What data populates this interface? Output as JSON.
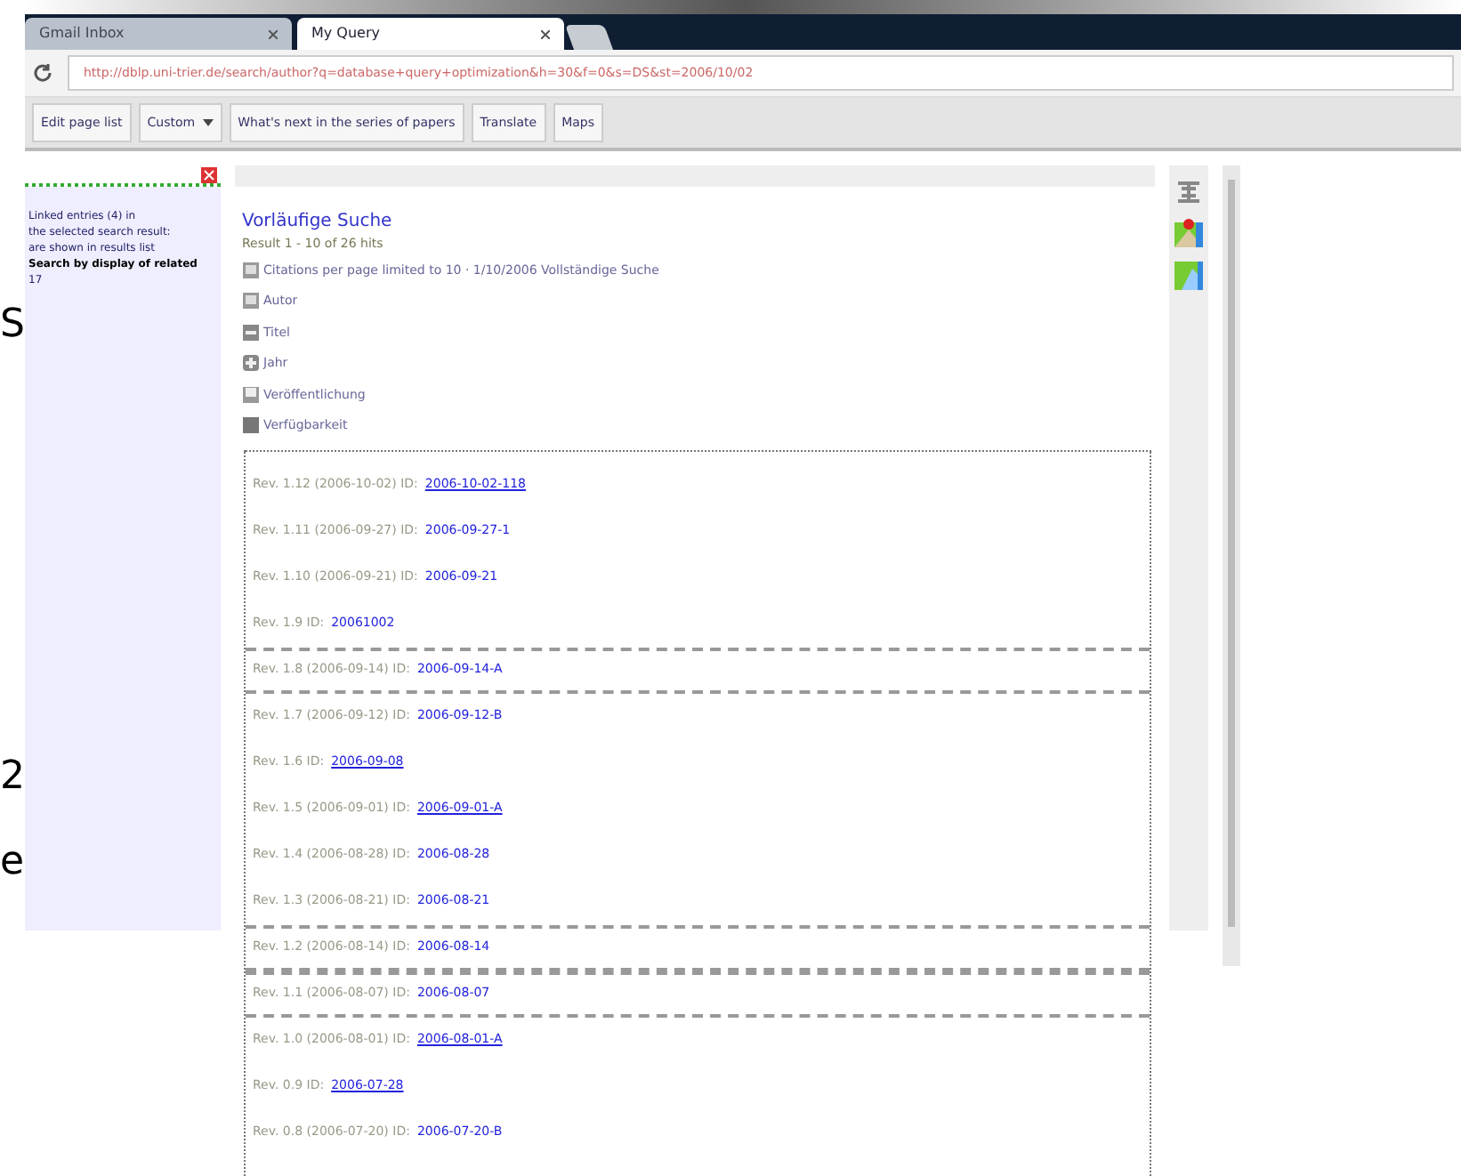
{
  "background_letters": [
    "S",
    "2",
    "e"
  ],
  "browser": {
    "tabs": [
      {
        "title": "Gmail Inbox",
        "selected": false
      },
      {
        "title": "My Query",
        "selected": true
      }
    ],
    "address": "http://dblp.uni-trier.de/search/author?q=database+query+optimization&h=30&f=0&s=DS&st=2006/10/02",
    "bookmarks": [
      {
        "label": "Edit page list",
        "menu": false
      },
      {
        "label": "Custom",
        "menu": true
      },
      {
        "label": "What's next in the series of papers",
        "menu": false
      },
      {
        "label": "Translate",
        "menu": false
      },
      {
        "label": "Maps",
        "menu": false
      }
    ]
  },
  "side_panel": {
    "lines": [
      "Linked entries (4) in ",
      "the selected search result:",
      "are shown in results list",
      "Search by display of related",
      "17"
    ]
  },
  "results": {
    "title": "Vorläufige Suche",
    "subtitle": "Result 1 - 10 of 26 hits",
    "filters": [
      {
        "kind": "list",
        "label": "Citations per page limited to 10 · 1/10/2006 Vollständige Suche"
      },
      {
        "kind": "list",
        "label": "Autor"
      },
      {
        "kind": "minus",
        "label": "Titel"
      },
      {
        "kind": "plus",
        "label": "Jahr"
      },
      {
        "kind": "tray",
        "label": "Veröffentlichung"
      },
      {
        "kind": "block",
        "label": "Verfügbarkeit"
      }
    ],
    "entries": [
      {
        "text": "Rev. 1.12 (2006-10-02) ID:",
        "link": "2006-10-02-118",
        "underlined": true,
        "boxed": false
      },
      {
        "text": "Rev. 1.11 (2006-09-27) ID:",
        "link": "2006-09-27-1",
        "underlined": false,
        "boxed": false
      },
      {
        "text": "Rev. 1.10 (2006-09-21) ID:",
        "link": "2006-09-21",
        "underlined": false,
        "boxed": false
      },
      {
        "text": "Rev. 1.9 ID:",
        "link": "20061002",
        "underlined": false,
        "boxed": false
      },
      {
        "text": "Rev. 1.8 (2006-09-14) ID:",
        "link": "2006-09-14-A",
        "underlined": false,
        "boxed": true
      },
      {
        "text": "Rev. 1.7 (2006-09-12) ID:",
        "link": "2006-09-12-B",
        "underlined": false,
        "boxed": false
      },
      {
        "text": "Rev. 1.6 ID:",
        "link": "2006-09-08",
        "underlined": true,
        "boxed": false
      },
      {
        "text": "Rev. 1.5 (2006-09-01) ID:",
        "link": "2006-09-01-A",
        "underlined": true,
        "boxed": false
      },
      {
        "text": "Rev. 1.4 (2006-08-28) ID:",
        "link": "2006-08-28",
        "underlined": false,
        "boxed": false
      },
      {
        "text": "Rev. 1.3 (2006-08-21) ID:",
        "link": "2006-08-21",
        "underlined": false,
        "boxed": false
      },
      {
        "text": "Rev. 1.2 (2006-08-14) ID:",
        "link": "2006-08-14",
        "underlined": false,
        "boxed": true
      },
      {
        "text": "Rev. 1.1 (2006-08-07) ID:",
        "link": "2006-08-07",
        "underlined": false,
        "boxed": true
      },
      {
        "text": "Rev. 1.0 (2006-08-01) ID:",
        "link": "2006-08-01-A",
        "underlined": true,
        "boxed": false
      },
      {
        "text": "Rev. 0.9 ID:",
        "link": "2006-07-28",
        "underlined": true,
        "boxed": false
      },
      {
        "text": "Rev. 0.8 (2006-07-20) ID:",
        "link": "2006-07-20-B",
        "underlined": false,
        "boxed": false
      }
    ]
  }
}
